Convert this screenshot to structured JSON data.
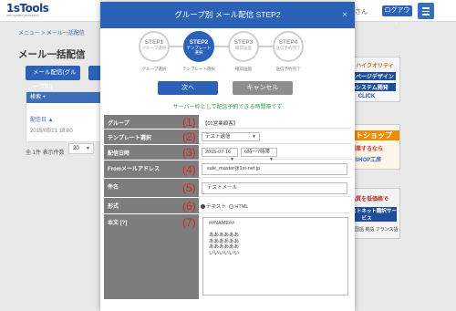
{
  "app": {
    "logo_main": "1sTools",
    "logo_sub": "web system production",
    "user_text": "さん",
    "logout_label": "ログアウト"
  },
  "breadcrumb": "メニュー > メール一括配信",
  "page_title": "メール一括配信",
  "bg_buttons": [
    "メール配信(グループ別)",
    ""
  ],
  "bg_panel": {
    "header": "検索 +",
    "column_head": "配信日 ▲",
    "date": "2015/05/21 18:00"
  },
  "bg_count": {
    "text": "全 1件 表示件数",
    "select_value": "20"
  },
  "ads": [
    {
      "line1": "中堅・ハイクオリティ",
      "line2": "ホームページデザイン",
      "line3": "webシステム開発",
      "line4": "CLICK"
    },
    {
      "line1": "ネットショップ",
      "line2": "開業するなら",
      "line3": "1SHOP工房"
    },
    {
      "line1": "高品質を低価格で",
      "line2": "ファーストネット翻訳サービス",
      "line3": "中国語 韓国語 英語 フランス語"
    }
  ],
  "modal": {
    "title": "グループ別 メール配信 STEP2",
    "close": "×",
    "steps": [
      {
        "label": "STEP1",
        "sub": "グループ選択",
        "caption": "グループ選択"
      },
      {
        "label": "STEP2",
        "sub": "テンプレート選択",
        "caption": "テンプレート選択"
      },
      {
        "label": "STEP3",
        "sub": "確認画面",
        "caption": "確認画面"
      },
      {
        "label": "STEP4",
        "sub": "送信予約完了",
        "caption": "送信予約完了"
      }
    ],
    "next_label": "次へ",
    "cancel_label": "キャンセル",
    "notice": "サーバー枠として配信予約できる時間帯です",
    "rows": [
      {
        "label": "グループ",
        "num": "(1)",
        "value": "【01営業顧客】"
      },
      {
        "label": "テンプレート選択",
        "num": "(2)",
        "value": "テスト送信"
      },
      {
        "label": "配信日時",
        "num": "(3)",
        "date": "2015-07-16",
        "time": "6時〜7時帯"
      },
      {
        "label": "Fromメールアドレス",
        "num": "(4)",
        "value": "sale_master@1st-net.jp"
      },
      {
        "label": "件名",
        "num": "(5)",
        "value": "テストメール"
      },
      {
        "label": "形式",
        "num": "(6)",
        "text_opt": "テキスト",
        "html_opt": "HTML"
      },
      {
        "label": "本文 [?]",
        "num": "(7)",
        "value": "##NAME##\n\nああああああ\nああああああ\nああああああ\nいいいいいい"
      }
    ]
  }
}
